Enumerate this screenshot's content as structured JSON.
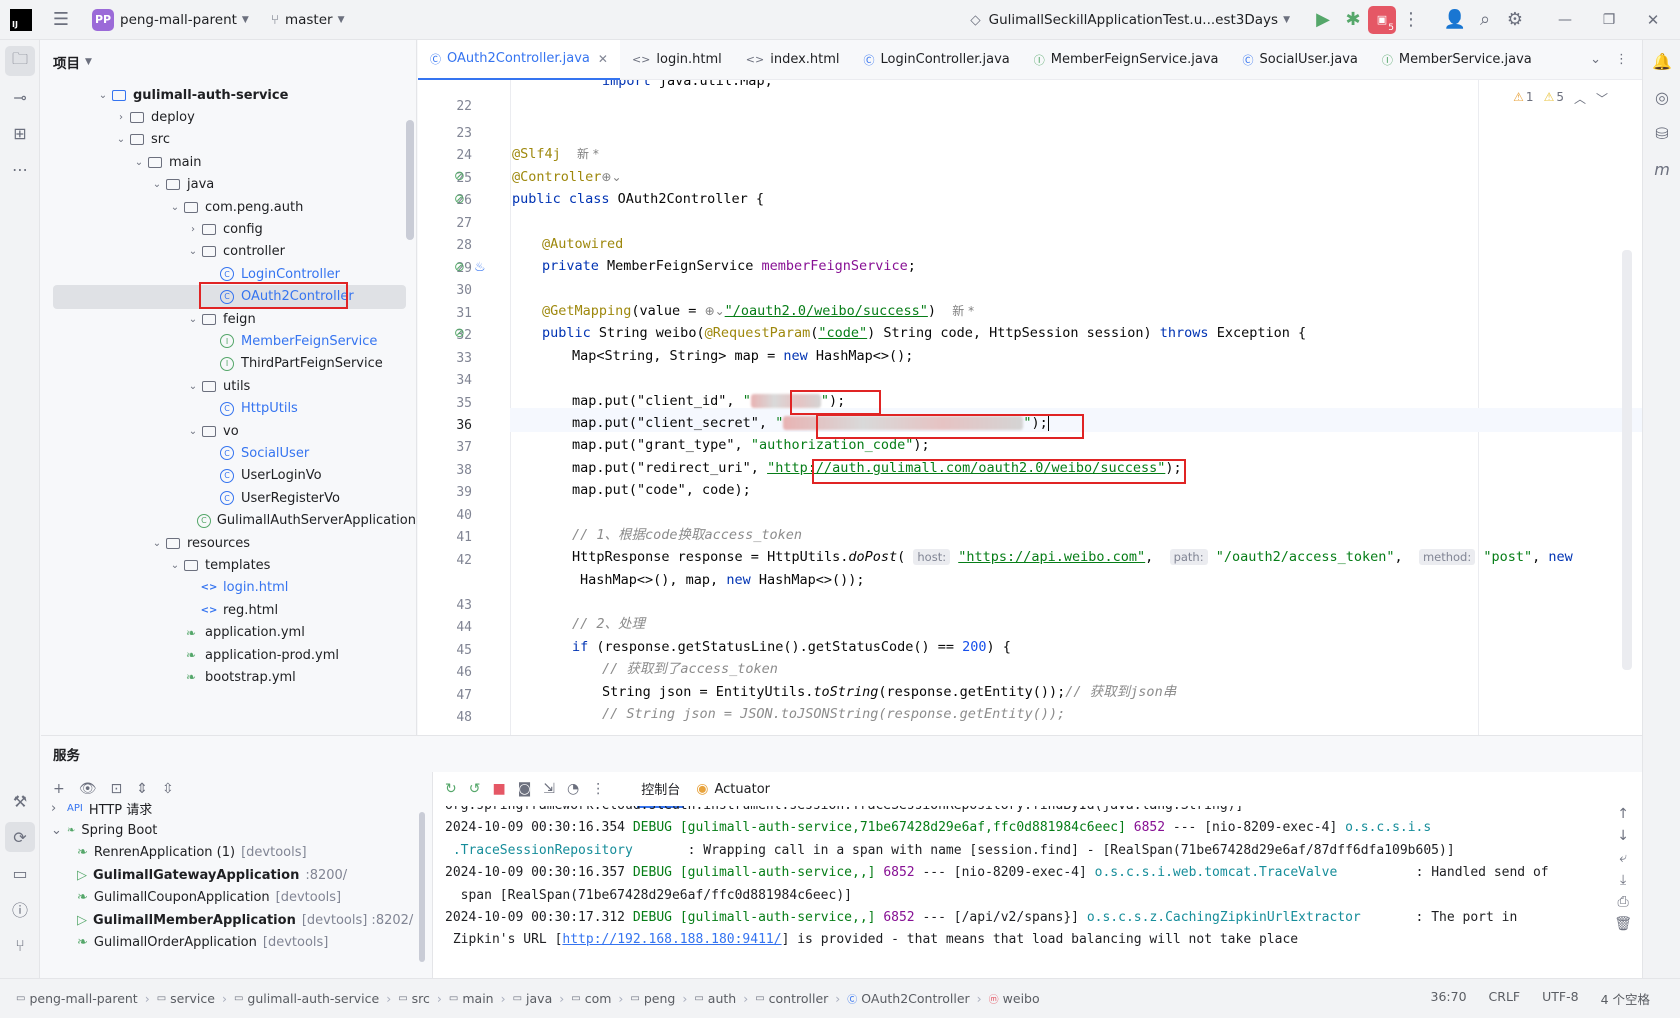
{
  "titlebar": {
    "project_badge": "PP",
    "project_name": "peng-mall-parent",
    "branch": "master",
    "run_config": "GulimallSeckillApplicationTest.u...est3Days",
    "services_count": "5"
  },
  "project_panel": {
    "title": "项目",
    "tree": [
      {
        "label": "gulimall-auth-service",
        "icon": "module-icon",
        "indent": 3,
        "arrow": "v",
        "bold": true
      },
      {
        "label": "deploy",
        "icon": "folder-icon",
        "indent": 4,
        "arrow": ">"
      },
      {
        "label": "src",
        "icon": "folder-icon",
        "indent": 4,
        "arrow": "v"
      },
      {
        "label": "main",
        "icon": "folder-icon",
        "indent": 5,
        "arrow": "v"
      },
      {
        "label": "java",
        "icon": "folder-icon",
        "indent": 6,
        "arrow": "v"
      },
      {
        "label": "com.peng.auth",
        "icon": "package-icon",
        "indent": 7,
        "arrow": "v"
      },
      {
        "label": "config",
        "icon": "package-icon",
        "indent": 8,
        "arrow": ">"
      },
      {
        "label": "controller",
        "icon": "package-icon",
        "indent": 8,
        "arrow": "v"
      },
      {
        "label": "LoginController",
        "icon": "class-icon",
        "indent": 9,
        "arrow": "",
        "blue": true
      },
      {
        "label": "OAuth2Controller",
        "icon": "class-icon",
        "indent": 9,
        "arrow": "",
        "blue": true,
        "selected": true
      },
      {
        "label": "feign",
        "icon": "package-icon",
        "indent": 8,
        "arrow": "v"
      },
      {
        "label": "MemberFeignService",
        "icon": "interface-icon",
        "indent": 9,
        "arrow": "",
        "blue": true
      },
      {
        "label": "ThirdPartFeignService",
        "icon": "interface-icon",
        "indent": 9,
        "arrow": ""
      },
      {
        "label": "utils",
        "icon": "package-icon",
        "indent": 8,
        "arrow": "v"
      },
      {
        "label": "HttpUtils",
        "icon": "class-icon",
        "indent": 9,
        "arrow": "",
        "blue": true
      },
      {
        "label": "vo",
        "icon": "package-icon",
        "indent": 8,
        "arrow": "v"
      },
      {
        "label": "SocialUser",
        "icon": "class-icon",
        "indent": 9,
        "arrow": "",
        "blue": true
      },
      {
        "label": "UserLoginVo",
        "icon": "class-icon",
        "indent": 9,
        "arrow": ""
      },
      {
        "label": "UserRegisterVo",
        "icon": "class-icon",
        "indent": 9,
        "arrow": ""
      },
      {
        "label": "GulimallAuthServerApplication",
        "icon": "spring-class-icon",
        "indent": 8,
        "arrow": ""
      },
      {
        "label": "resources",
        "icon": "folder-icon",
        "indent": 6,
        "arrow": "v"
      },
      {
        "label": "templates",
        "icon": "folder-icon",
        "indent": 7,
        "arrow": "v"
      },
      {
        "label": "login.html",
        "icon": "html-icon",
        "indent": 8,
        "arrow": "",
        "blue": true
      },
      {
        "label": "reg.html",
        "icon": "html-icon",
        "indent": 8,
        "arrow": ""
      },
      {
        "label": "application.yml",
        "icon": "yaml-icon",
        "indent": 7,
        "arrow": ""
      },
      {
        "label": "application-prod.yml",
        "icon": "yaml-icon",
        "indent": 7,
        "arrow": ""
      },
      {
        "label": "bootstrap.yml",
        "icon": "yaml-icon",
        "indent": 7,
        "arrow": ""
      }
    ]
  },
  "editor": {
    "tabs": [
      {
        "label": "OAuth2Controller.java",
        "icon": "class-icon",
        "active": true
      },
      {
        "label": "login.html",
        "icon": "html-icon"
      },
      {
        "label": "index.html",
        "icon": "html-icon"
      },
      {
        "label": "LoginController.java",
        "icon": "class-icon"
      },
      {
        "label": "MemberFeignService.java",
        "icon": "interface-icon"
      },
      {
        "label": "SocialUser.java",
        "icon": "class-icon"
      },
      {
        "label": "MemberService.java",
        "icon": "interface-icon"
      }
    ],
    "warnings": "1",
    "weak_warnings": "5",
    "line_numbers": [
      "22",
      "23",
      "24",
      "25",
      "26",
      "27",
      "28",
      "29",
      "30",
      "31",
      "32",
      "33",
      "34",
      "35",
      "36",
      "37",
      "38",
      "39",
      "40",
      "41",
      "42",
      "",
      "43",
      "44",
      "45",
      "46",
      "47",
      "48"
    ],
    "code": {
      "l22": "import java.util.Map;",
      "new_marker": "新 *",
      "slf4j": "@Slf4j",
      "controller_ann": "@Controller",
      "class_decl_kw": "public class",
      "class_name": " OAuth2Controller {",
      "autowired": "@Autowired",
      "field_kw": "private",
      "field_type": " MemberFeignService ",
      "field_name": "memberFeignService",
      "getmapping": "@GetMapping",
      "getmapping_value": "(value = ",
      "mapping_path": "\"/oauth2.0/weibo/success\"",
      "method_sig_kw": "public",
      "method_sig": " String weibo(",
      "request_param": "@RequestParam",
      "request_param_val": "\"code\"",
      "method_params": ") String code, HttpSession session) ",
      "throws": "throws",
      "exception": " Exception {",
      "map_decl": "Map<String, String> map = ",
      "new_kw": "new",
      "map_new": " HashMap<>();",
      "put_client_id": "map.put(\"client_id\", ",
      "put_client_secret": "map.put(\"client_secret\", ",
      "put_grant_type": "map.put(\"grant_type\", ",
      "grant_type_val": "\"authorization_code\"",
      "put_redirect": "map.put(\"redirect_uri\", ",
      "redirect_val": "\"http://auth.gulimall.com/oauth2.0/weibo/success\"",
      "put_code": "map.put(\"code\", code);",
      "comment1": "// 1、根据code换取access_token",
      "http_decl": "HttpResponse response = HttpUtils.",
      "do_post": "doPost",
      "hint_host": "host:",
      "host_val": "\"https://api.weibo.com\"",
      "hint_path": "path:",
      "path_val": "\"/oauth2/access_token\"",
      "hint_method": "method:",
      "method_val": "\"post\"",
      "cont_line": "HashMap<>(), map, ",
      "cont_end": " HashMap<>());",
      "comment2": "// 2、处理",
      "if_kw": "if",
      "if_cond": " (response.getStatusLine().getStatusCode() == ",
      "status_200": "200",
      "if_end": ") {",
      "comment3": "// 获取到了access_token",
      "json_decl": "String json = EntityUtils.",
      "to_string": "toString",
      "json_end": "(response.getEntity());",
      "comment4": "// 获取到json串",
      "comment5": "// String json = JSON.toJSONString(response.getEntity());"
    }
  },
  "services": {
    "title": "服务",
    "tree": [
      {
        "label": "HTTP 请求",
        "extra": "",
        "indent": 0,
        "arrow": ">"
      },
      {
        "label": "Spring Boot",
        "extra": "",
        "indent": 0,
        "arrow": "v"
      },
      {
        "label": "RenrenApplication (1)",
        "extra": "[devtools]",
        "indent": 1,
        "running": false
      },
      {
        "label": "GulimallGatewayApplication",
        "extra": ":8200/",
        "indent": 1,
        "running": true
      },
      {
        "label": "GulimallCouponApplication",
        "extra": "[devtools]",
        "indent": 1,
        "running": false
      },
      {
        "label": "GulimallMemberApplication",
        "extra": "[devtools] :8202/",
        "indent": 1,
        "running": true
      },
      {
        "label": "GulimallOrderApplication",
        "extra": "[devtools]",
        "indent": 1,
        "running": false
      }
    ],
    "console_tabs": {
      "console": "控制台",
      "actuator": "Actuator"
    },
    "console": [
      {
        "text": "org.springframework.cloud.sleuth.instrument.session.TraceSessionRepository.findById(java.lang.String)]"
      },
      {
        "date": "2024-10-09 00:30:16.354",
        "level": "DEBUG",
        "ctx": "[gulimall-auth-service,71be67428d29e6af,ffc0d881984c6eec]",
        "pid": "6852",
        "thread": "--- [nio-8209-exec-4]",
        "logger": "o.s.c.s.i.s",
        "msg": ""
      },
      {
        "text": " .TraceSessionRepository",
        "tail": "       : Wrapping call in a span with name [session.find] - [RealSpan(71be67428d29e6af/87dff6dfa109b605)]"
      },
      {
        "date": "2024-10-09 00:30:16.357",
        "level": "DEBUG",
        "ctx": "[gulimall-auth-service,,]",
        "pid": "6852",
        "thread": "--- [nio-8209-exec-4]",
        "logger": "o.s.c.s.i.web.tomcat.TraceValve",
        "msg": "          : Handled send of"
      },
      {
        "text": "  span [RealSpan(71be67428d29e6af/ffc0d881984c6eec)]"
      },
      {
        "date": "2024-10-09 00:30:17.312",
        "level": "DEBUG",
        "ctx": "[gulimall-auth-service,,]",
        "pid": "6852",
        "thread": "--- [/api/v2/spans}]",
        "logger": "o.s.c.s.z.CachingZipkinUrlExtractor",
        "msg": "       : The port in"
      },
      {
        "text": " Zipkin's URL [",
        "link": "http://192.168.188.180:9411/",
        "tail": "] is provided - that means that load balancing will not take place"
      }
    ]
  },
  "statusbar": {
    "breadcrumbs": [
      "peng-mall-parent",
      "service",
      "gulimall-auth-service",
      "src",
      "main",
      "java",
      "com",
      "peng",
      "auth",
      "controller",
      "OAuth2Controller",
      "weibo"
    ],
    "position": "36:70",
    "line_sep": "CRLF",
    "encoding": "UTF-8",
    "indent": "4 个空格"
  },
  "colors": {
    "accent": "#3574f0",
    "highlight_box": "#e02424"
  }
}
